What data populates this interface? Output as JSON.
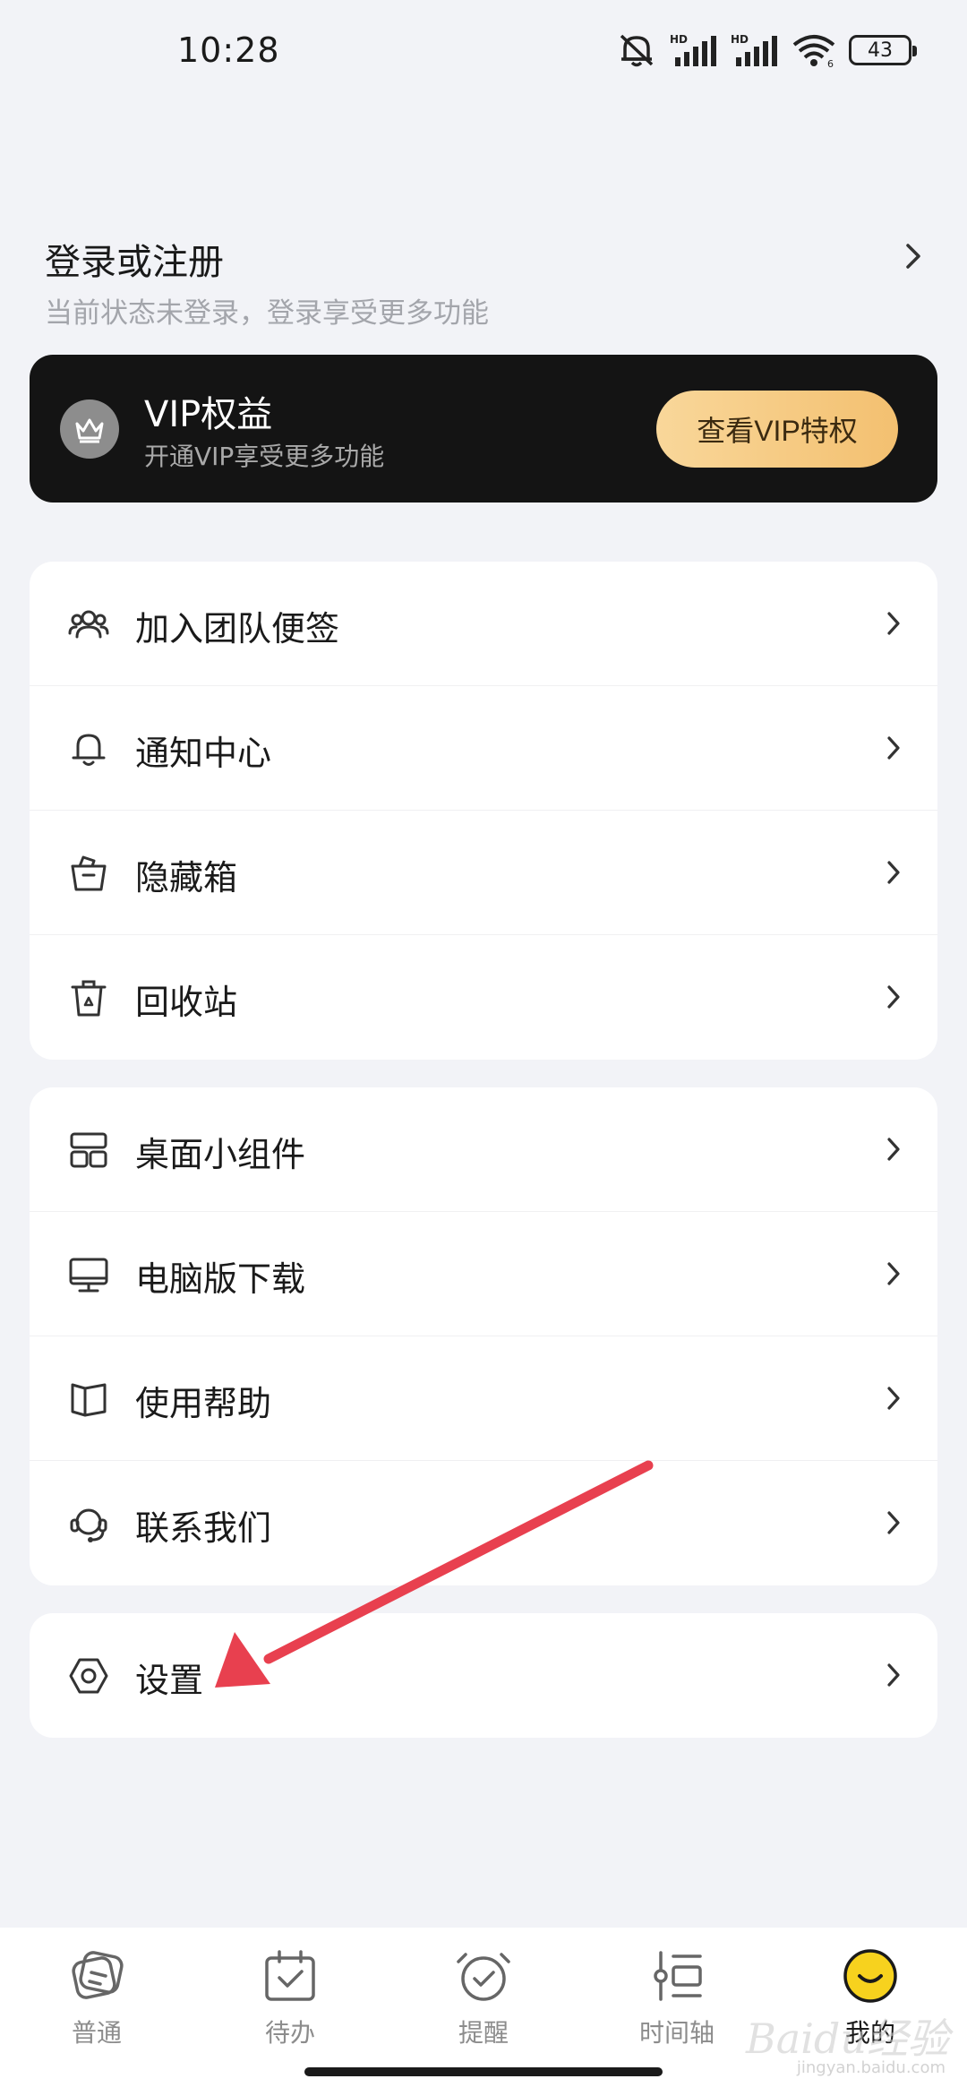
{
  "status_bar": {
    "time": "10:28",
    "battery": "43",
    "icons": [
      "mute-icon",
      "hd-signal-icon",
      "hd-signal-icon",
      "wifi-icon",
      "battery-icon"
    ],
    "hd_label": "HD"
  },
  "login": {
    "title": "登录或注册",
    "subtitle": "当前状态未登录，登录享受更多功能"
  },
  "vip": {
    "title": "VIP权益",
    "subtitle": "开通VIP享受更多功能",
    "button": "查看VIP特权",
    "badge_icon": "crown-icon"
  },
  "group1": [
    {
      "label": "加入团队便签",
      "icon": "team-icon"
    },
    {
      "label": "通知中心",
      "icon": "bell-icon"
    },
    {
      "label": "隐藏箱",
      "icon": "hidden-box-icon"
    },
    {
      "label": "回收站",
      "icon": "recycle-bin-icon"
    }
  ],
  "group2": [
    {
      "label": "桌面小组件",
      "icon": "widget-icon"
    },
    {
      "label": "电脑版下载",
      "icon": "desktop-icon"
    },
    {
      "label": "使用帮助",
      "icon": "help-book-icon"
    },
    {
      "label": "联系我们",
      "icon": "headset-icon"
    }
  ],
  "group3": [
    {
      "label": "设置",
      "icon": "settings-icon"
    }
  ],
  "bottom_nav": [
    {
      "label": "普通",
      "icon": "note-icon",
      "active": false
    },
    {
      "label": "待办",
      "icon": "todo-icon",
      "active": false
    },
    {
      "label": "提醒",
      "icon": "alarm-icon",
      "active": false
    },
    {
      "label": "时间轴",
      "icon": "timeline-icon",
      "active": false
    },
    {
      "label": "我的",
      "icon": "profile-face-icon",
      "active": true
    }
  ],
  "watermark": {
    "brand": "Baidu经验",
    "url": "jingyan.baidu.com"
  },
  "colors": {
    "background": "#f2f3f7",
    "vip_card": "#141414",
    "vip_button": "#f5c878",
    "active_nav": "#f7d21e",
    "annotation_arrow": "#e8404f"
  }
}
